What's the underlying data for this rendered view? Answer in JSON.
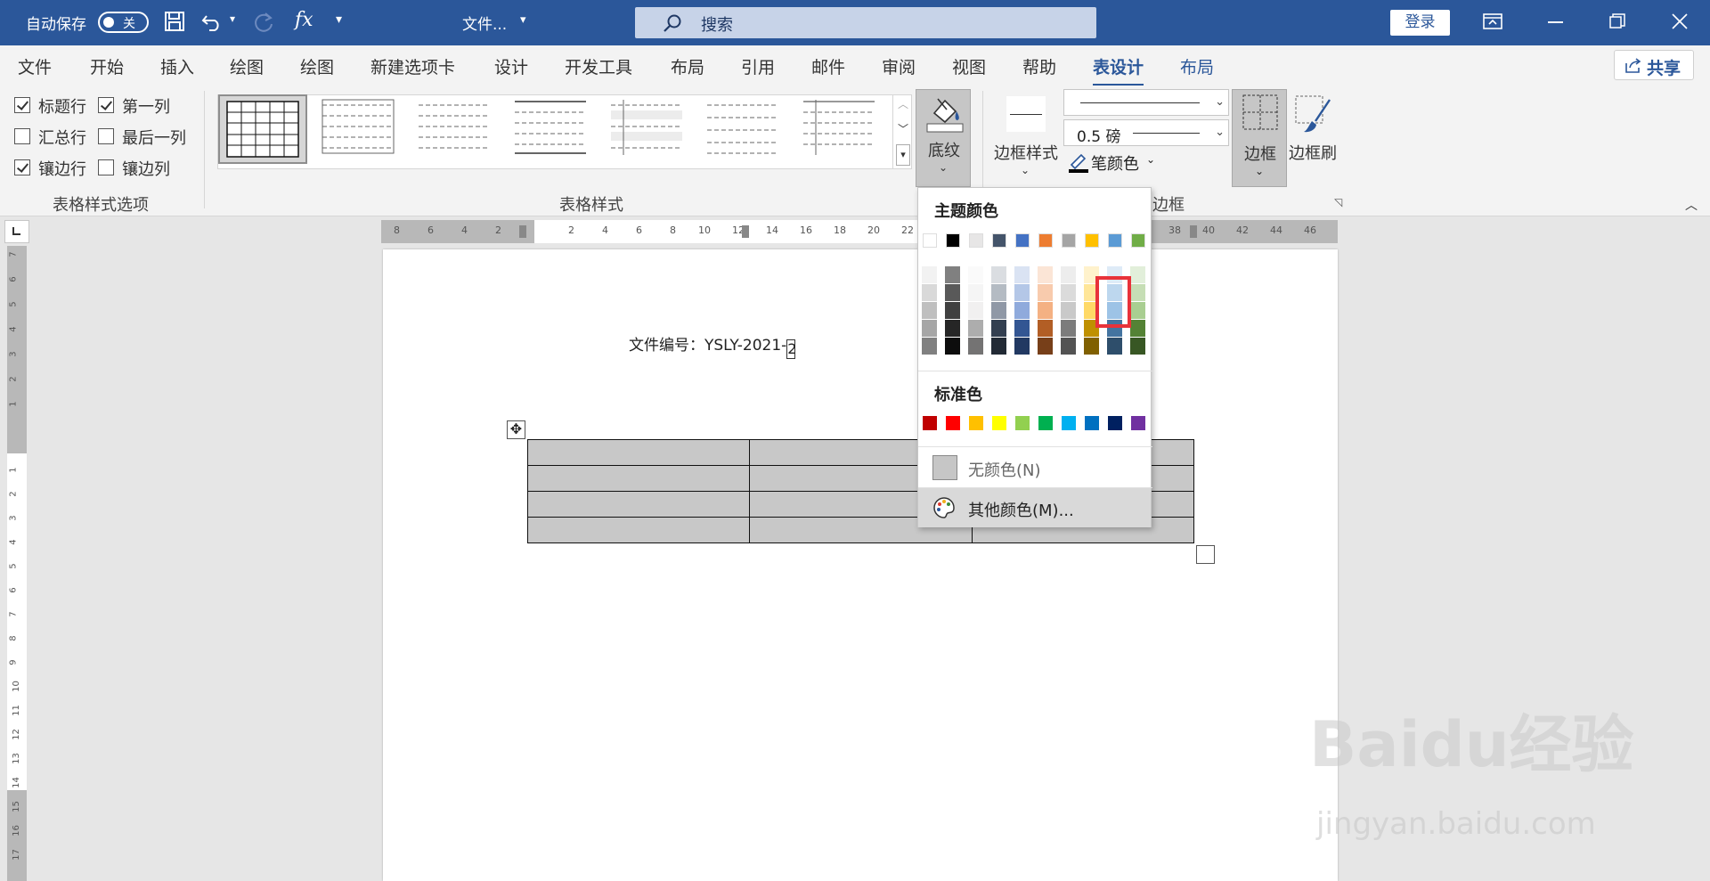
{
  "titlebar": {
    "autosave_label": "自动保存",
    "autosave_state": "关",
    "doc_title": "文件...",
    "search_placeholder": "搜索",
    "login": "登录"
  },
  "tabs": [
    "文件",
    "开始",
    "插入",
    "绘图",
    "绘图",
    "新建选项卡",
    "设计",
    "开发工具",
    "布局",
    "引用",
    "邮件",
    "审阅",
    "视图",
    "帮助",
    "表设计",
    "布局"
  ],
  "active_tab": "表设计",
  "share": "共享",
  "style_options": {
    "header_row": "标题行",
    "first_column": "第一列",
    "total_row": "汇总行",
    "last_column": "最后一列",
    "banded_rows": "镶边行",
    "banded_columns": "镶边列",
    "group_label": "表格样式选项"
  },
  "table_styles": {
    "group_label": "表格样式"
  },
  "shading": {
    "label": "底纹"
  },
  "borders": {
    "border_styles": "边框样式",
    "pen_weight": "0.5 磅",
    "pen_color": "笔颜色",
    "borders_btn": "边框",
    "border_painter": "边框刷",
    "group_label": "边框"
  },
  "document": {
    "file_number_label": "文件编号：YSLY-2021-",
    "cursor_char": "2"
  },
  "color_panel": {
    "theme_colors_label": "主题颜色",
    "standard_colors_label": "标准色",
    "no_color": "无颜色(N)",
    "more_colors": "其他颜色(M)...",
    "theme_colors": [
      "#ffffff",
      "#000000",
      "#e7e6e6",
      "#44546a",
      "#4472c4",
      "#ed7d31",
      "#a5a5a5",
      "#ffc000",
      "#5b9bd5",
      "#70ad47"
    ],
    "standard_colors": [
      "#c00000",
      "#ff0000",
      "#ffc000",
      "#ffff00",
      "#92d050",
      "#00b050",
      "#00b0f0",
      "#0070c0",
      "#002060",
      "#7030a0"
    ]
  },
  "ruler_h_ticks": [
    "8",
    "6",
    "4",
    "2",
    "2",
    "4",
    "6",
    "8",
    "10",
    "12",
    "14",
    "16",
    "18",
    "20",
    "22",
    "38",
    "40",
    "42",
    "44",
    "46"
  ],
  "ruler_v_ticks": [
    "7",
    "6",
    "5",
    "4",
    "3",
    "2",
    "1",
    "1",
    "2",
    "3",
    "4",
    "5",
    "6",
    "7",
    "8",
    "9",
    "10",
    "11",
    "12",
    "13",
    "14",
    "15",
    "16",
    "17"
  ],
  "watermark": {
    "brand": "Baidu经验",
    "url": "jingyan.baidu.com"
  }
}
